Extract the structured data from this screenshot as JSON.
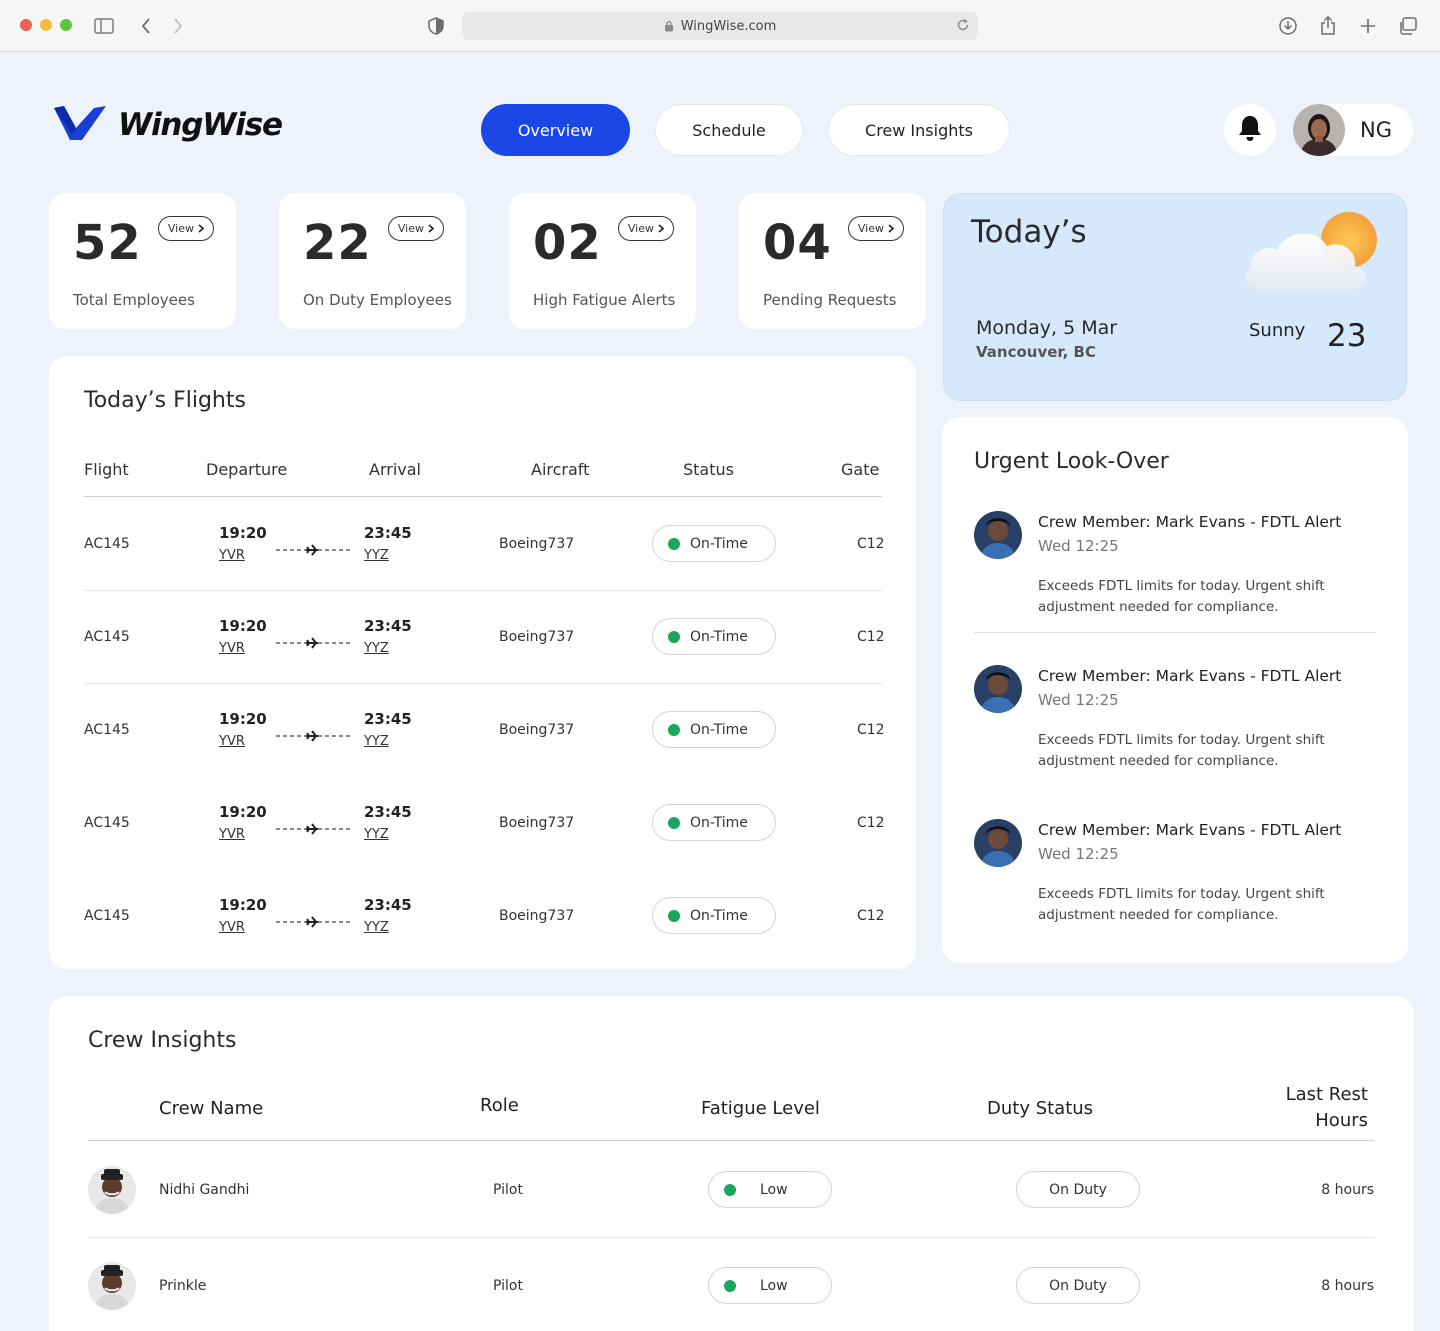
{
  "browser": {
    "url": "WingWise.com"
  },
  "brand": {
    "name": "WingWise",
    "accent": "#1a47e6"
  },
  "nav": {
    "overview": "Overview",
    "schedule": "Schedule",
    "crew_insights": "Crew Insights"
  },
  "user": {
    "initials": "NG"
  },
  "stats": [
    {
      "value": "52",
      "label": "Total Employees",
      "view": "View"
    },
    {
      "value": "22",
      "label": "On Duty Employees",
      "view": "View"
    },
    {
      "value": "02",
      "label": "High Fatigue Alerts",
      "view": "View"
    },
    {
      "value": "04",
      "label": "Pending Requests",
      "view": "View"
    }
  ],
  "weather": {
    "title": "Today’s",
    "date": "Monday, 5 Mar",
    "location": "Vancouver, BC",
    "condition": "Sunny",
    "temp": "23"
  },
  "flights": {
    "title": "Today’s Flights",
    "headers": {
      "flight": "Flight",
      "departure": "Departure",
      "arrival": "Arrival",
      "aircraft": "Aircraft",
      "status": "Status",
      "gate": "Gate"
    },
    "rows": [
      {
        "flight": "AC145",
        "dep_time": "19:20",
        "dep_code": "YVR",
        "arr_time": "23:45",
        "arr_code": "YYZ",
        "aircraft": "Boeing737",
        "status": "On-Time",
        "gate": "C12"
      },
      {
        "flight": "AC145",
        "dep_time": "19:20",
        "dep_code": "YVR",
        "arr_time": "23:45",
        "arr_code": "YYZ",
        "aircraft": "Boeing737",
        "status": "On-Time",
        "gate": "C12"
      },
      {
        "flight": "AC145",
        "dep_time": "19:20",
        "dep_code": "YVR",
        "arr_time": "23:45",
        "arr_code": "YYZ",
        "aircraft": "Boeing737",
        "status": "On-Time",
        "gate": "C12"
      },
      {
        "flight": "AC145",
        "dep_time": "19:20",
        "dep_code": "YVR",
        "arr_time": "23:45",
        "arr_code": "YYZ",
        "aircraft": "Boeing737",
        "status": "On-Time",
        "gate": "C12"
      },
      {
        "flight": "AC145",
        "dep_time": "19:20",
        "dep_code": "YVR",
        "arr_time": "23:45",
        "arr_code": "YYZ",
        "aircraft": "Boeing737",
        "status": "On-Time",
        "gate": "C12"
      }
    ]
  },
  "urgent": {
    "title": "Urgent Look-Over",
    "items": [
      {
        "title": "Crew Member: Mark Evans - FDTL Alert",
        "time": "Wed 12:25",
        "text": "Exceeds FDTL limits for today. Urgent shift adjustment needed for compliance."
      },
      {
        "title": "Crew Member: Mark Evans - FDTL Alert",
        "time": "Wed 12:25",
        "text": "Exceeds FDTL limits for today. Urgent shift adjustment needed for compliance."
      },
      {
        "title": "Crew Member: Mark Evans - FDTL Alert",
        "time": "Wed 12:25",
        "text": "Exceeds FDTL limits for today. Urgent shift adjustment needed for compliance."
      }
    ]
  },
  "crew": {
    "title": "Crew Insights",
    "headers": {
      "name": "Crew Name",
      "role": "Role",
      "fatigue": "Fatigue Level",
      "duty": "Duty Status",
      "rest_1": "Last Rest",
      "rest_2": "Hours"
    },
    "rows": [
      {
        "name": "Nidhi Gandhi",
        "role": "Pilot",
        "fatigue": "Low",
        "duty": "On Duty",
        "rest": "8 hours"
      },
      {
        "name": "Prinkle",
        "role": "Pilot",
        "fatigue": "Low",
        "duty": "On Duty",
        "rest": "8 hours"
      }
    ]
  },
  "colors": {
    "status_green": "#1aa65b",
    "weather_bg": "#d6e8fb",
    "page_bg": "#eef3fb"
  }
}
